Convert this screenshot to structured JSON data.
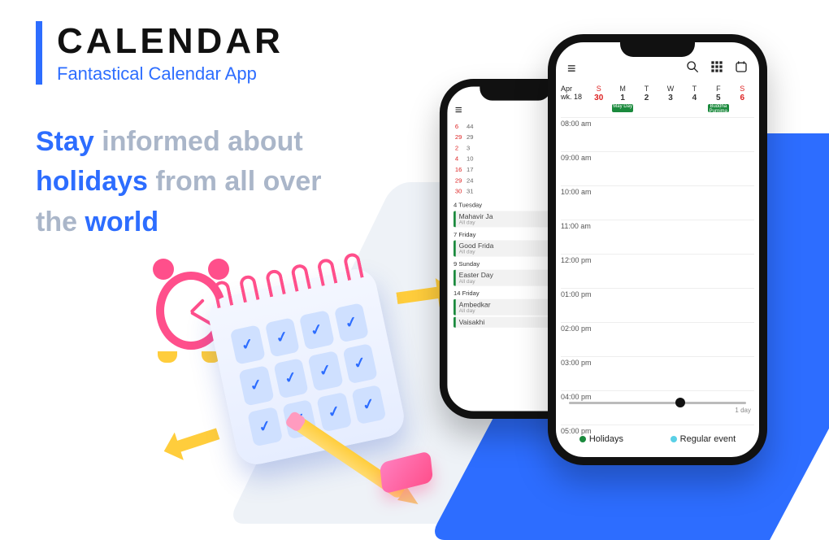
{
  "heading": {
    "title": "CALENDAR",
    "subtitle": "Fantastical Calendar App"
  },
  "tagline": {
    "w1": "Stay",
    "w2": "informed about",
    "w3": "holidays",
    "w4": "from all over",
    "w5": "the",
    "w6": "world"
  },
  "frontPhone": {
    "month": "Apr",
    "weekLabel": "wk. 18",
    "days": [
      {
        "name": "S",
        "num": "30",
        "red": true,
        "chip": ""
      },
      {
        "name": "M",
        "num": "1",
        "red": false,
        "chip": "May Day"
      },
      {
        "name": "T",
        "num": "2",
        "red": false,
        "chip": ""
      },
      {
        "name": "W",
        "num": "3",
        "red": false,
        "chip": ""
      },
      {
        "name": "T",
        "num": "4",
        "red": false,
        "chip": ""
      },
      {
        "name": "F",
        "num": "5",
        "red": false,
        "chip": "Buddha Purnima"
      },
      {
        "name": "S",
        "num": "6",
        "red": true,
        "chip": ""
      }
    ],
    "hours": [
      "08:00 am",
      "09:00 am",
      "10:00 am",
      "11:00 am",
      "12:00 pm",
      "01:00 pm",
      "02:00 pm",
      "03:00 pm",
      "04:00 pm",
      "05:00 pm"
    ],
    "sliderLabel": "1 day",
    "legend": {
      "holidays": "Holidays",
      "regular": "Regular event"
    }
  },
  "backPhone": {
    "miniMonth": {
      "colRed": [
        "6",
        "29",
        "2",
        "4",
        "16",
        "29",
        "30"
      ],
      "colGray": [
        "44",
        "29",
        "3",
        "10",
        "17",
        "24",
        "31"
      ]
    },
    "agenda": [
      {
        "day": "4 Tuesday",
        "title": "Mahavir Ja",
        "sub": "All day"
      },
      {
        "day": "7 Friday",
        "title": "Good Frida",
        "sub": "All day"
      },
      {
        "day": "9 Sunday",
        "title": "Easter Day",
        "sub": "All day"
      },
      {
        "day": "14 Friday",
        "title": "Ambedkar",
        "sub": "All day"
      },
      {
        "day": "",
        "title": "Vaisakhi",
        "sub": ""
      }
    ]
  }
}
